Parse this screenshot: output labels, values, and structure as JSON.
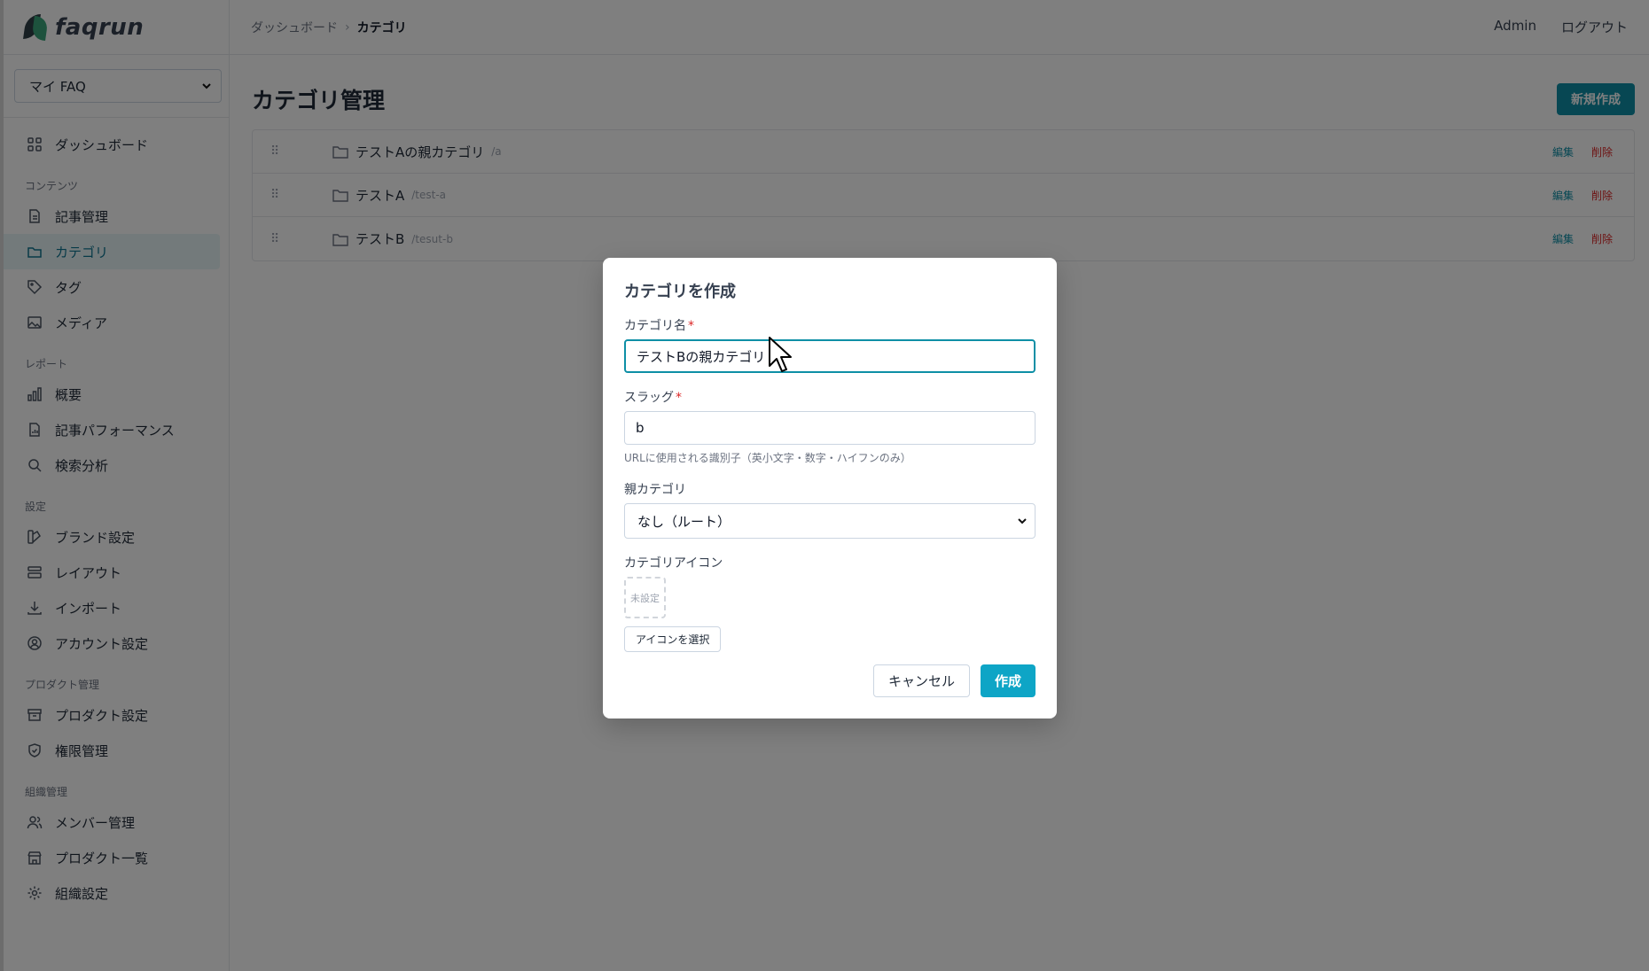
{
  "app": {
    "logo_text": "faqrun"
  },
  "sidebar": {
    "faq_select": "マイ FAQ",
    "dashboard": "ダッシュボード",
    "sections": {
      "content": "コンテンツ",
      "report": "レポート",
      "settings": "設定",
      "product": "プロダクト管理",
      "org": "組織管理"
    },
    "items": {
      "articles": "記事管理",
      "categories": "カテゴリ",
      "tags": "タグ",
      "media": "メディア",
      "overview": "概要",
      "article_perf": "記事パフォーマンス",
      "search_analysis": "検索分析",
      "brand": "ブランド設定",
      "layout": "レイアウト",
      "import": "インポート",
      "account": "アカウント設定",
      "product_settings": "プロダクト設定",
      "permissions": "権限管理",
      "members": "メンバー管理",
      "product_list": "プロダクト一覧",
      "org_settings": "組織設定"
    }
  },
  "header": {
    "breadcrumb": [
      "ダッシュボード",
      "カテゴリ"
    ],
    "user": "Admin",
    "logout": "ログアウト"
  },
  "main": {
    "title": "カテゴリ管理",
    "new_button": "新規作成",
    "edit_label": "編集",
    "delete_label": "削除",
    "categories": [
      {
        "name": "テストAの親カテゴリ",
        "slug": "/a"
      },
      {
        "name": "テストA",
        "slug": "/test-a"
      },
      {
        "name": "テストB",
        "slug": "/tesut-b"
      }
    ]
  },
  "modal": {
    "title": "カテゴリを作成",
    "name_label": "カテゴリ名",
    "name_value": "テストBの親カテゴリ",
    "slug_label": "スラッグ",
    "slug_value": "b",
    "slug_hint": "URLに使用される識別子（英小文字・数字・ハイフンのみ）",
    "parent_label": "親カテゴリ",
    "parent_value": "なし（ルート）",
    "icon_label": "カテゴリアイコン",
    "icon_unset": "未設定",
    "choose_icon": "アイコンを選択",
    "cancel": "キャンセル",
    "create": "作成",
    "required_mark": "*"
  },
  "colors": {
    "accent": "#0e8fa6",
    "create_button": "#0ea5c6",
    "danger": "#dc2626"
  }
}
